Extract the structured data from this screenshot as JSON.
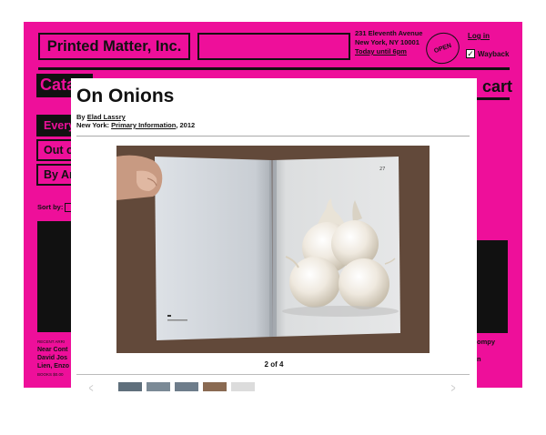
{
  "site": {
    "logo": "Printed Matter, Inc.",
    "address": {
      "line1": "231 Eleventh Avenue",
      "line2": "New York, NY 10001",
      "line3": "Today until 6pm"
    },
    "open_badge": "OPEN",
    "login": "Log in",
    "wayback": "Wayback",
    "wayback_checked": true,
    "catalog": "Cata",
    "cart": "cart",
    "sidebar": [
      {
        "label": "Every",
        "active": true
      },
      {
        "label": "Out o",
        "active": false
      },
      {
        "label": "By Ar",
        "active": false
      }
    ],
    "sort_by_label": "Sort by:",
    "recent": {
      "tag": "RECENT ARRI",
      "line1": "Near Cont",
      "line2": "David Jos",
      "line3": "Lien, Enzo",
      "price": "BOOKS $0.00"
    },
    "right_fragment": "ompy",
    "right_fragment2": "n"
  },
  "modal": {
    "title": "On Onions",
    "by_prefix": "By",
    "author": "Elad Lassry",
    "place": "New York:",
    "publisher": "Primary Information",
    "year": ", 2012",
    "counter": "2 of 4",
    "prev_icon": "chevron-left-icon",
    "next_icon": "chevron-right-icon",
    "page_number": "27"
  },
  "colors": {
    "brand_magenta": "#ee0f9a",
    "ink": "#111111"
  }
}
